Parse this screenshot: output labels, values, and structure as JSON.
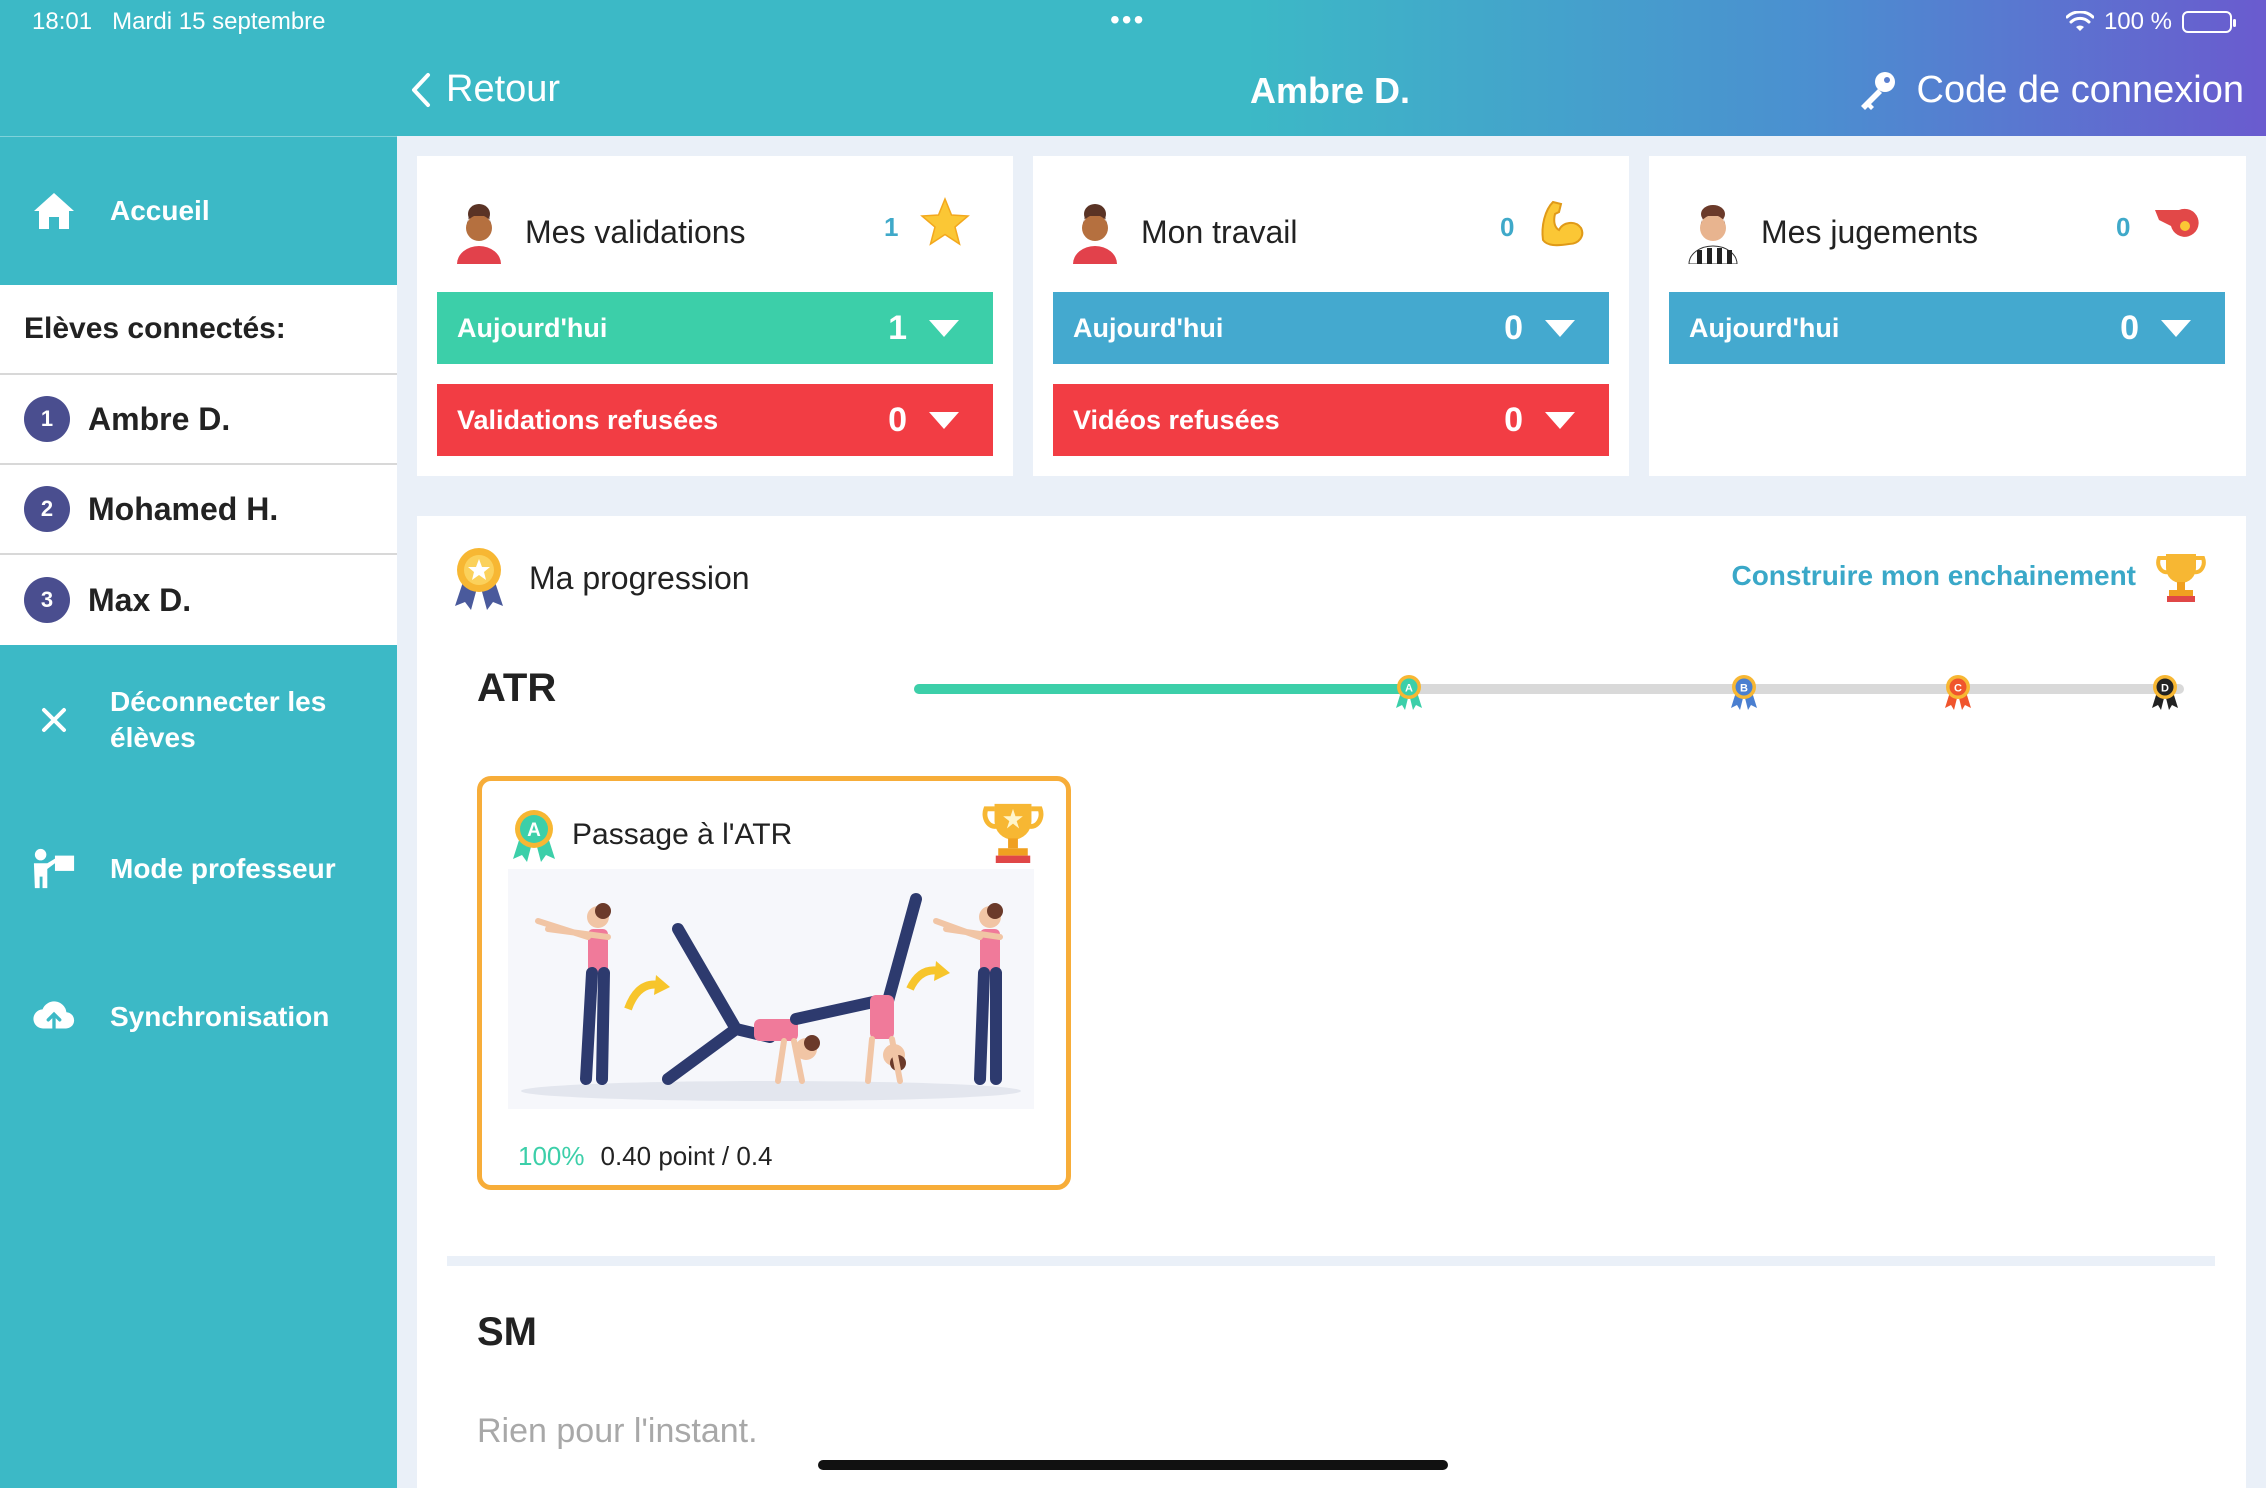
{
  "status": {
    "time": "18:01",
    "date": "Mardi 15 septembre",
    "dots": "•••",
    "battery": "100 %"
  },
  "nav": {
    "back_label": "Retour",
    "title": "Ambre D.",
    "code_label": "Code de connexion"
  },
  "sidebar": {
    "home_label": "Accueil",
    "students_header": "Elèves connectés:",
    "students": [
      {
        "num": "1",
        "name": "Ambre D."
      },
      {
        "num": "2",
        "name": "Mohamed H."
      },
      {
        "num": "3",
        "name": "Max D."
      }
    ],
    "disconnect_label_1": "Déconnecter les",
    "disconnect_label_2": "élèves",
    "teacher_label": "Mode professeur",
    "sync_label": "Synchronisation"
  },
  "cards": {
    "validations": {
      "title": "Mes validations",
      "count": "1",
      "today_label": "Aujourd'hui",
      "today_value": "1",
      "refused_label": "Validations refusées",
      "refused_value": "0"
    },
    "work": {
      "title": "Mon travail",
      "count": "0",
      "today_label": "Aujourd'hui",
      "today_value": "0",
      "refused_label": "Vidéos refusées",
      "refused_value": "0"
    },
    "judgements": {
      "title": "Mes jugements",
      "count": "0",
      "today_label": "Aujourd'hui",
      "today_value": "0"
    }
  },
  "progress": {
    "title": "Ma progression",
    "build_label": "Construire mon enchainement",
    "sections": [
      {
        "name": "ATR",
        "progress": 0.39,
        "milestones": [
          "A",
          "B",
          "C",
          "D"
        ],
        "milestone_colors": [
          "#3ccfa9",
          "#4a7fd0",
          "#f0552d",
          "#222222"
        ]
      },
      {
        "name": "SM",
        "empty_text": "Rien pour l'instant."
      }
    ],
    "skill": {
      "badge": "A",
      "title": "Passage à l'ATR",
      "percent": "100%",
      "points": "0.40 point / 0.4"
    }
  }
}
